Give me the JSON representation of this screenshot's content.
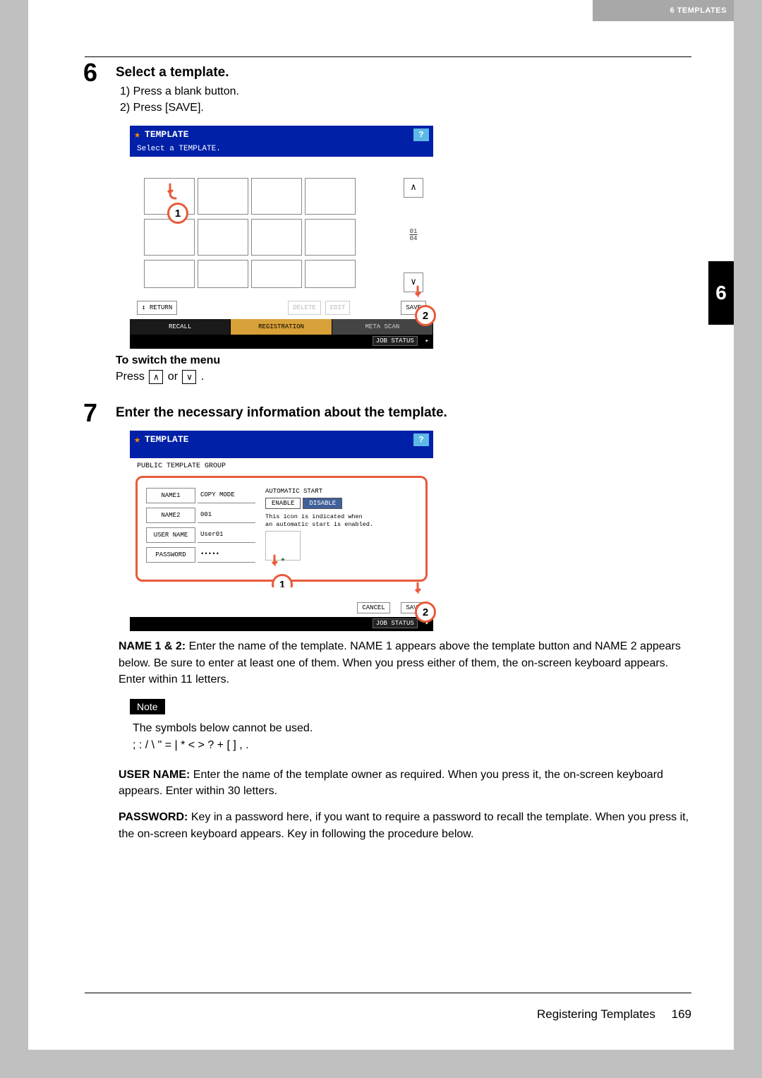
{
  "header": {
    "chapter": "6 TEMPLATES"
  },
  "side_tab": "6",
  "step6": {
    "num": "6",
    "title": "Select a template.",
    "sub1": "1)  Press a blank button.",
    "sub2": "2)  Press [SAVE].",
    "switch_heading": "To switch the menu",
    "press_text_a": "Press ",
    "press_text_b": " or ",
    "press_text_c": " ."
  },
  "fig1": {
    "title": "TEMPLATE",
    "subtitle": "Select a TEMPLATE.",
    "help": "?",
    "pager_top": "01",
    "pager_bot": "04",
    "btn_return": "↥ RETURN",
    "btn_delete": "DELETE",
    "btn_edit": "EDIT",
    "btn_save": "SAVE",
    "tab_recall": "RECALL",
    "tab_reg": "REGISTRATION",
    "tab_meta": "META SCAN",
    "status": "JOB STATUS",
    "callout1": "1",
    "callout2": "2"
  },
  "step7": {
    "num": "7",
    "title": "Enter the necessary information about the template."
  },
  "fig2": {
    "title": "TEMPLATE",
    "help": "?",
    "group": "PUBLIC TEMPLATE GROUP",
    "labels": {
      "name1": "NAME1",
      "name2": "NAME2",
      "user": "USER NAME",
      "pass": "PASSWORD"
    },
    "vals": {
      "name1": "COPY MODE",
      "name2": "001",
      "user": "User01",
      "pass": "•••••"
    },
    "as_label": "AUTOMATIC START",
    "as_enable": "ENABLE",
    "as_disable": "DISABLE",
    "hint1": "This icon is indicated when",
    "hint2": "an automatic start is enabled.",
    "btn_cancel": "CANCEL",
    "btn_save": "SAVE",
    "status": "JOB STATUS",
    "callout1": "1",
    "callout2": "2"
  },
  "explain": {
    "name12_a": "NAME 1 & 2:",
    "name12_b": " Enter the name of the template. NAME 1 appears above the template button and NAME 2 appears below. Be sure to enter at least one of them. When you press either of them, the on-screen keyboard appears. Enter within 11 letters.",
    "note_badge": "Note",
    "note1": "The symbols below cannot be used.",
    "note2": "; : / \\ \" = | * < > ? + [ ] , .",
    "user_a": "USER NAME:",
    "user_b": " Enter the name of the template owner as required. When you press it, the on-screen keyboard appears. Enter within 30 letters.",
    "pass_a": "PASSWORD:",
    "pass_b": " Key in a password here, if you want to require a password to recall the template. When you press it, the on-screen keyboard appears. Key in following the procedure below."
  },
  "footer": {
    "title": "Registering Templates",
    "page": "169"
  }
}
